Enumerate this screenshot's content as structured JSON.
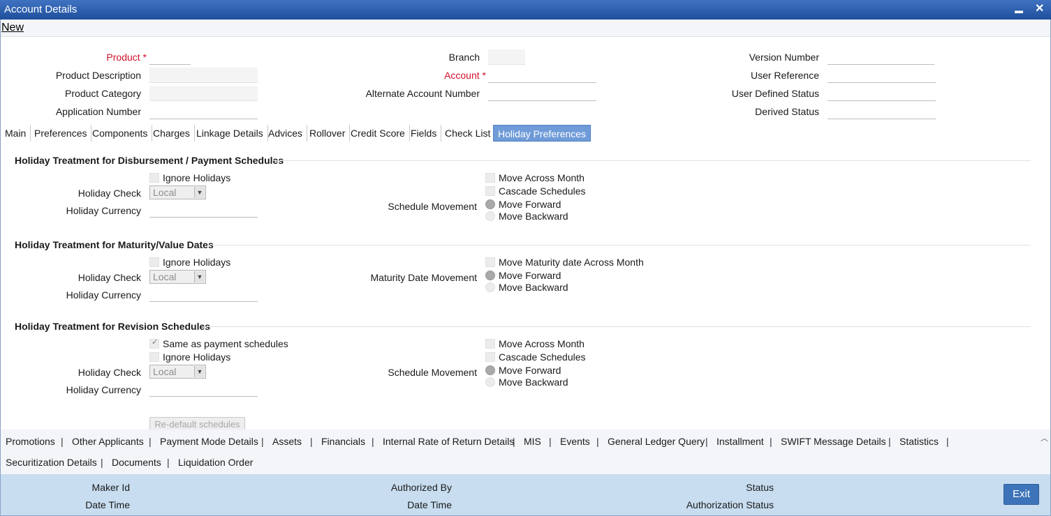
{
  "window": {
    "title": "Account Details",
    "minimize": "▬",
    "close": "✕"
  },
  "menu": {
    "new_label": "New"
  },
  "header": {
    "product": "Product",
    "product_description": "Product Description",
    "product_category": "Product Category",
    "application_number": "Application Number",
    "branch": "Branch",
    "account": "Account",
    "alternate_account_number": "Alternate Account Number",
    "version_number": "Version Number",
    "user_reference": "User Reference",
    "user_defined_status": "User Defined Status",
    "derived_status": "Derived Status",
    "required_mark": "*"
  },
  "tabs": [
    "Main",
    "Preferences",
    "Components",
    "Charges",
    "Linkage Details",
    "Advices",
    "Rollover",
    "Credit Score",
    "Fields",
    "Check List",
    "Holiday Preferences"
  ],
  "active_tab": "Holiday Preferences",
  "sections": {
    "disbursement": {
      "title": "Holiday Treatment for Disbursement / Payment Schedules",
      "ignore_holidays": "Ignore Holidays",
      "holiday_check": "Holiday Check",
      "holiday_check_value": "Local",
      "holiday_currency": "Holiday Currency",
      "movement_label": "Schedule Movement",
      "move_across_month": "Move Across Month",
      "cascade_schedules": "Cascade Schedules",
      "move_forward": "Move Forward",
      "move_backward": "Move Backward"
    },
    "maturity": {
      "title": "Holiday Treatment for Maturity/Value Dates",
      "ignore_holidays": "Ignore Holidays",
      "holiday_check": "Holiday Check",
      "holiday_check_value": "Local",
      "holiday_currency": "Holiday Currency",
      "movement_label": "Maturity Date Movement",
      "move_across_month": "Move Maturity date Across Month",
      "move_forward": "Move Forward",
      "move_backward": "Move Backward"
    },
    "revision": {
      "title": "Holiday Treatment for Revision Schedules",
      "same_as_payment": "Same as payment schedules",
      "ignore_holidays": "Ignore Holidays",
      "holiday_check": "Holiday Check",
      "holiday_check_value": "Local",
      "holiday_currency": "Holiday Currency",
      "movement_label": "Schedule Movement",
      "move_across_month": "Move Across Month",
      "cascade_schedules": "Cascade Schedules",
      "move_forward": "Move Forward",
      "move_backward": "Move Backward",
      "redefault_button": "Re-default schedules"
    }
  },
  "sublinks_row1": [
    "Promotions",
    "Other Applicants",
    "Payment Mode Details",
    "Assets",
    "Financials",
    "Internal Rate of Return Details",
    "MIS",
    "Events",
    "General Ledger Query",
    "Installment",
    "SWIFT Message Details",
    "Statistics"
  ],
  "sublinks_row2": [
    "Securitization Details",
    "Documents",
    "Liquidation Order"
  ],
  "separator": "|",
  "scroll_up": "︿",
  "footer": {
    "maker_id": "Maker Id",
    "date_time_1": "Date Time",
    "authorized_by": "Authorized By",
    "date_time_2": "Date Time",
    "status": "Status",
    "authorization_status": "Authorization Status",
    "exit": "Exit"
  }
}
